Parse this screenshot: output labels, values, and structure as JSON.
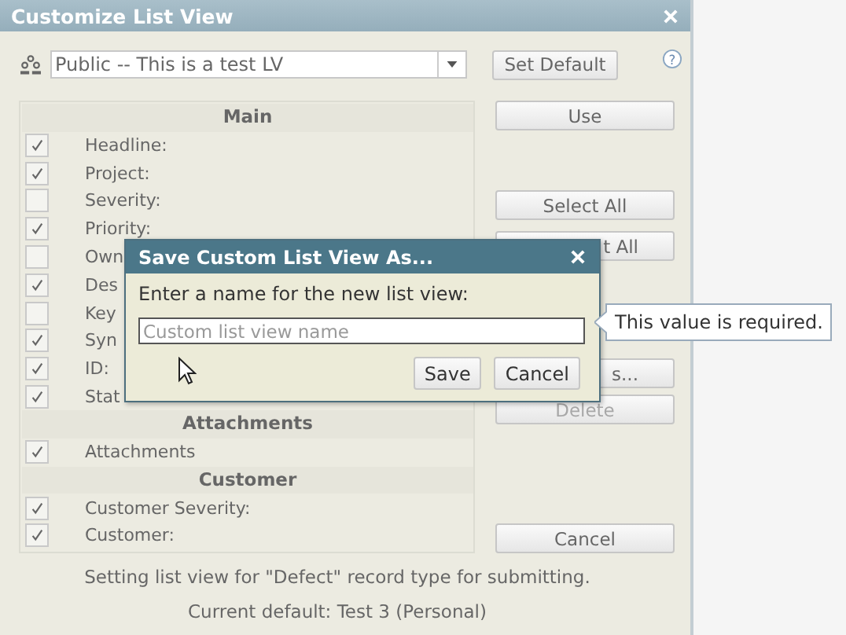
{
  "window": {
    "title": "Customize List View"
  },
  "view_select": {
    "value": "Public -- This is a test LV"
  },
  "set_default_button": "Set Default",
  "sections": [
    {
      "title": "Main",
      "fields": [
        {
          "label": "Headline:",
          "checked": true
        },
        {
          "label": "Project:",
          "checked": true
        },
        {
          "label": "Severity:",
          "checked": false
        },
        {
          "label": "Priority:",
          "checked": true
        },
        {
          "label": "Own",
          "checked": false
        },
        {
          "label": "Des",
          "checked": true
        },
        {
          "label": "Key",
          "checked": false
        },
        {
          "label": "Syn",
          "checked": true
        },
        {
          "label": "ID:",
          "checked": true
        },
        {
          "label": "Stat",
          "checked": true
        }
      ]
    },
    {
      "title": "Attachments",
      "fields": [
        {
          "label": "Attachments",
          "checked": true
        }
      ]
    },
    {
      "title": "Customer",
      "fields": [
        {
          "label": "Customer Severity:",
          "checked": true
        },
        {
          "label": "Customer:",
          "checked": true
        }
      ]
    }
  ],
  "button_groups": [
    [
      {
        "label": "Use",
        "disabled": false,
        "clipped": false
      }
    ],
    [
      {
        "label": "Select All",
        "disabled": false,
        "clipped": false
      },
      {
        "label": "t All",
        "disabled": false,
        "clipped": true
      }
    ],
    [
      {
        "label": "s...",
        "disabled": false,
        "clipped": true
      },
      {
        "label": "Delete",
        "disabled": true,
        "clipped": false
      }
    ],
    [
      {
        "label": "Cancel",
        "disabled": false,
        "clipped": false
      }
    ]
  ],
  "footer": [
    "Setting list view for \"Defect\" record type for submitting.",
    "Current default: Test 3 (Personal)"
  ],
  "modal": {
    "title": "Save Custom List View As...",
    "prompt": "Enter a name for the new list view:",
    "placeholder": "Custom list view name",
    "buttons": [
      "Save",
      "Cancel"
    ]
  },
  "tooltip": "This value is required.",
  "help_icon": "?"
}
